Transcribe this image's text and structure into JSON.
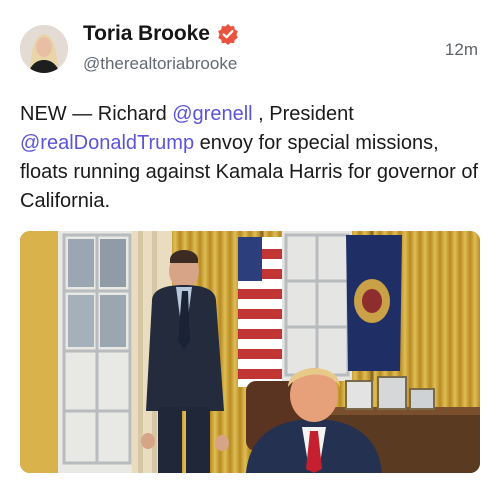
{
  "author": {
    "display_name": "Toria Brooke",
    "handle": "@therealtoriabrooke",
    "avatar_icon": "avatar-photo",
    "verified_icon": "verified-badge-icon"
  },
  "timestamp": "12m",
  "post": {
    "part1": "NEW — Richard ",
    "mention1": "@grenell",
    "part2": " , President ",
    "mention2": "@realDonaldTrump",
    "part3": " envoy for special missions, floats running against Kamala Harris for governor of California."
  },
  "colors": {
    "mention": "#5b55d6",
    "verified": "#e9543f",
    "gold_curtain": "#c9a43c"
  }
}
